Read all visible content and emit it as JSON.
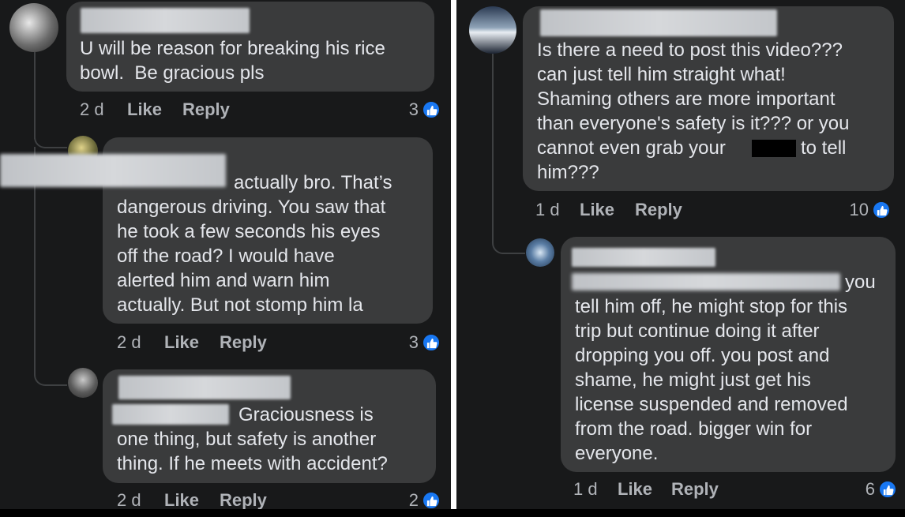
{
  "left": {
    "comments": [
      {
        "author": "",
        "lines": [
          "U will be reason for breaking his rice",
          "bowl.  Be gracious pls"
        ],
        "time": "2 d",
        "like_label": "Like",
        "reply_label": "Reply",
        "reactions": "3"
      },
      {
        "author": "",
        "line1_rest": "actually bro. That’s",
        "lines": [
          "dangerous driving. You saw that",
          "he took a few seconds his eyes",
          "off the road? I would have",
          "alerted him and warn him",
          "actually. But not stomp him la"
        ],
        "time": "2 d",
        "like_label": "Like",
        "reply_label": "Reply",
        "reactions": "3"
      },
      {
        "author": "",
        "line1_rest": "Graciousness is",
        "lines": [
          "one thing, but safety is another",
          "thing. If he meets with accident?"
        ],
        "time": "2 d",
        "like_label": "Like",
        "reply_label": "Reply",
        "reactions": "2"
      }
    ]
  },
  "right": {
    "comments": [
      {
        "author": "",
        "line1": "Is there a need to post this video???",
        "lines": [
          "can just tell him straight what!",
          "Shaming others are more important",
          "than everyone's safety is it??? or you"
        ],
        "line5_start": "cannot even grab your",
        "line5_end": "to tell",
        "line6": "him???",
        "time": "1 d",
        "like_label": "Like",
        "reply_label": "Reply",
        "reactions": "10"
      },
      {
        "author": "",
        "line1_end": "you",
        "lines": [
          "tell him off, he might stop for this",
          "trip but continue doing it after",
          "dropping you off. you post and",
          "shame, he might just get his",
          "license suspended and removed",
          "from the road. bigger win for",
          "everyone."
        ],
        "time": "1 d",
        "like_label": "Like",
        "reply_label": "Reply",
        "reactions": "6"
      }
    ]
  },
  "colors": {
    "background": "#18191a",
    "bubble": "#3a3b3c",
    "text": "#e4e6eb",
    "meta": "#b0b3b8",
    "like_blue": "#1877f2"
  }
}
